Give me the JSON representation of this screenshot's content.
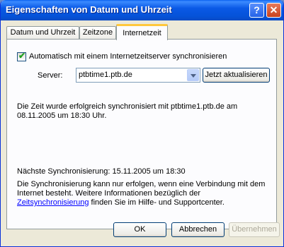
{
  "window": {
    "title": "Eigenschaften von Datum und Uhrzeit",
    "help_glyph": "?",
    "close_glyph": "✕"
  },
  "tabs": [
    {
      "label": "Datum und Uhrzeit"
    },
    {
      "label": "Zeitzone"
    },
    {
      "label": "Internetzeit",
      "selected": true
    }
  ],
  "sync": {
    "checkbox_label": "Automatisch mit einem Internetzeitserver synchronisieren",
    "checkbox_checked": true,
    "server_label": "Server:",
    "server_value": "ptbtime1.ptb.de",
    "update_button": "Jetzt aktualisieren"
  },
  "messages": {
    "success": "Die Zeit wurde erfolgreich synchronisiert mit ptbtime1.ptb.de am 08.11.2005 um 18:30 Uhr.",
    "next_sync": "Nächste Synchronisierung: 15.11.2005 um 18:30",
    "info_before": "Die Synchronisierung kann nur erfolgen, wenn eine Verbindung mit dem Internet besteht. Weitere Informationen bezüglich der ",
    "info_link": "Zeitsynchronisierung",
    "info_after": " finden Sie im Hilfe- und Supportcenter."
  },
  "buttons": {
    "ok": "OK",
    "cancel": "Abbrechen",
    "apply": "Übernehmen"
  },
  "colors": {
    "title_bar": "#0a59e6",
    "dialog_bg": "#ece9d8",
    "tab_highlight": "#ffc83c",
    "link": "#0000ff"
  }
}
